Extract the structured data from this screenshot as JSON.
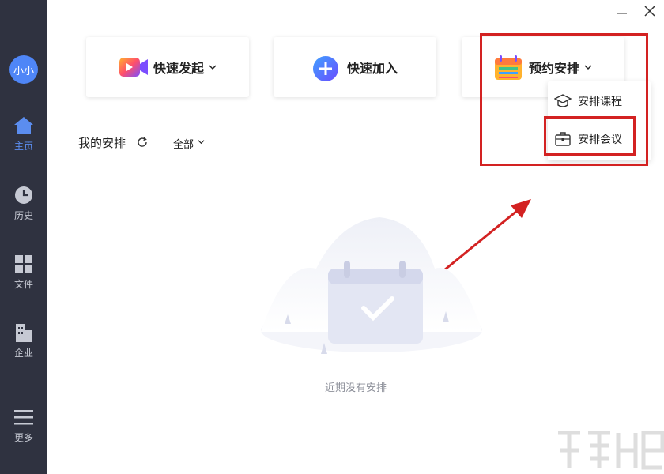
{
  "sidebar": {
    "avatar": "小小",
    "items": [
      {
        "label": "主页",
        "icon": "home-icon",
        "active": true
      },
      {
        "label": "历史",
        "icon": "clock-icon",
        "active": false
      },
      {
        "label": "文件",
        "icon": "grid-icon",
        "active": false
      },
      {
        "label": "企业",
        "icon": "building-icon",
        "active": false
      },
      {
        "label": "更多",
        "icon": "menu-icon",
        "active": false
      }
    ]
  },
  "actions": {
    "quick_start": "快速发起",
    "quick_join": "快速加入",
    "schedule": "预约安排"
  },
  "schedule_menu": {
    "course": "安排课程",
    "meeting": "安排会议"
  },
  "section": {
    "title": "我的安排",
    "filter": "全部"
  },
  "empty_state": {
    "text": "近期没有安排"
  },
  "colors": {
    "sidebar_bg": "#2f3240",
    "accent": "#5b8def",
    "annotation": "#d32222"
  }
}
